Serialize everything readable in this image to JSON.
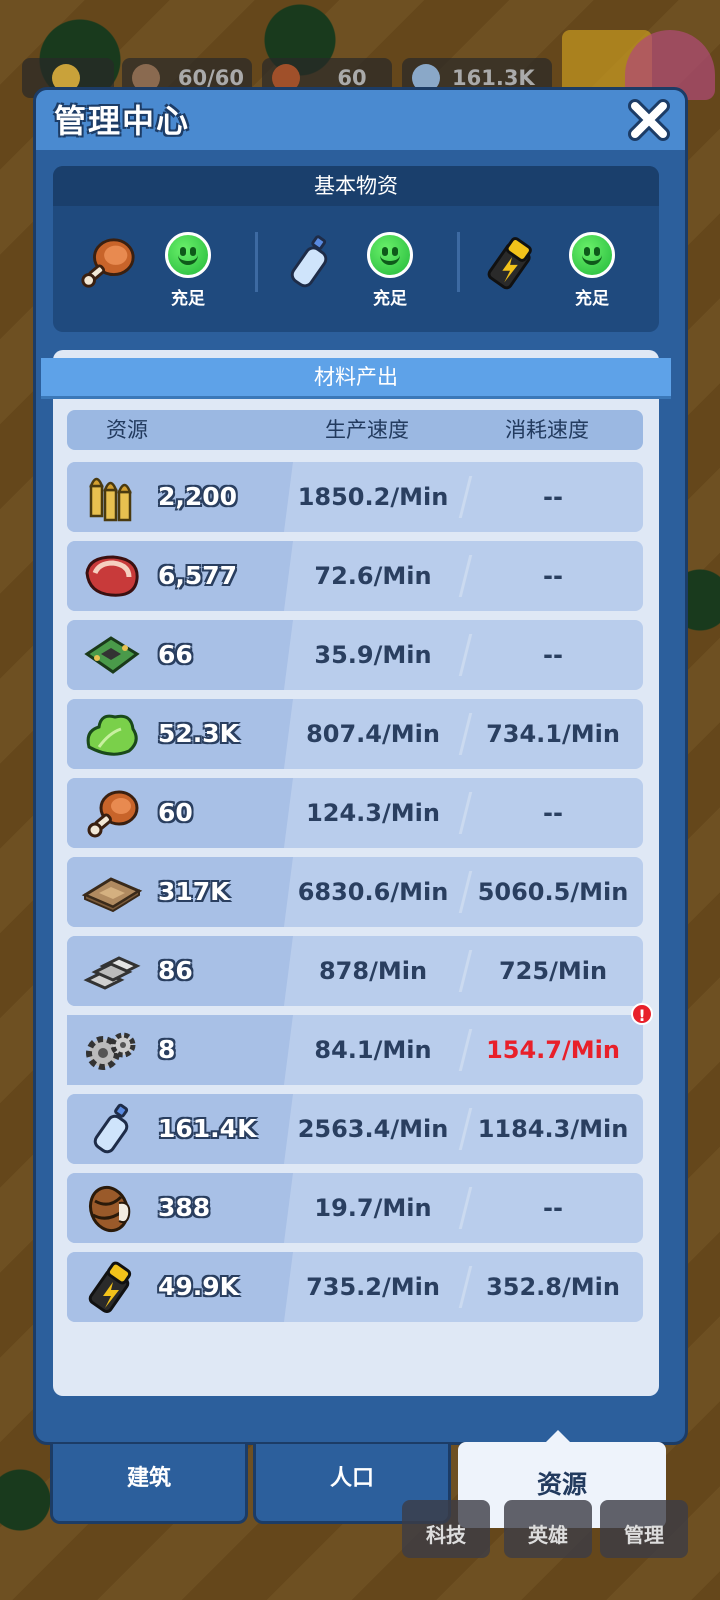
{
  "hud": {
    "population": "60/60",
    "meat": "60",
    "water": "161.3K"
  },
  "modal": {
    "title": "管理中心",
    "basic_section": {
      "title": "基本物资",
      "items": [
        {
          "icon": "meat-icon",
          "status": "充足"
        },
        {
          "icon": "water-bottle-icon",
          "status": "充足"
        },
        {
          "icon": "battery-icon",
          "status": "充足"
        }
      ]
    },
    "materials": {
      "title": "材料产出",
      "headers": {
        "resource": "资源",
        "production": "生产速度",
        "consumption": "消耗速度"
      },
      "rows": [
        {
          "icon": "bullets-icon",
          "amount": "2,200",
          "production": "1850.2/Min",
          "consumption": "--"
        },
        {
          "icon": "steak-icon",
          "amount": "6,577",
          "production": "72.6/Min",
          "consumption": "--"
        },
        {
          "icon": "circuit-board-icon",
          "amount": "66",
          "production": "35.9/Min",
          "consumption": "--"
        },
        {
          "icon": "lettuce-icon",
          "amount": "52.3K",
          "production": "807.4/Min",
          "consumption": "734.1/Min"
        },
        {
          "icon": "meat-icon",
          "amount": "60",
          "production": "124.3/Min",
          "consumption": "--"
        },
        {
          "icon": "leather-icon",
          "amount": "317K",
          "production": "6830.6/Min",
          "consumption": "5060.5/Min"
        },
        {
          "icon": "iron-ingot-icon",
          "amount": "86",
          "production": "878/Min",
          "consumption": "725/Min"
        },
        {
          "icon": "gears-icon",
          "amount": "8",
          "production": "84.1/Min",
          "consumption": "154.7/Min",
          "warning": true
        },
        {
          "icon": "water-bottle-icon",
          "amount": "161.4K",
          "production": "2563.4/Min",
          "consumption": "1184.3/Min"
        },
        {
          "icon": "barrel-icon",
          "amount": "388",
          "production": "19.7/Min",
          "consumption": "--"
        },
        {
          "icon": "battery-icon",
          "amount": "49.9K",
          "production": "735.2/Min",
          "consumption": "352.8/Min"
        }
      ]
    }
  },
  "tabs": [
    {
      "label": "建筑"
    },
    {
      "label": "人口"
    },
    {
      "label": "资源",
      "active": true
    }
  ],
  "bottom_buttons": [
    {
      "label": "科技"
    },
    {
      "label": "英雄"
    },
    {
      "label": "管理"
    }
  ],
  "colors": {
    "panel_blue": "#2c5f9c",
    "header_blue": "#4a8ad0",
    "warning_red": "#e8202a",
    "status_green": "#22b83a"
  }
}
